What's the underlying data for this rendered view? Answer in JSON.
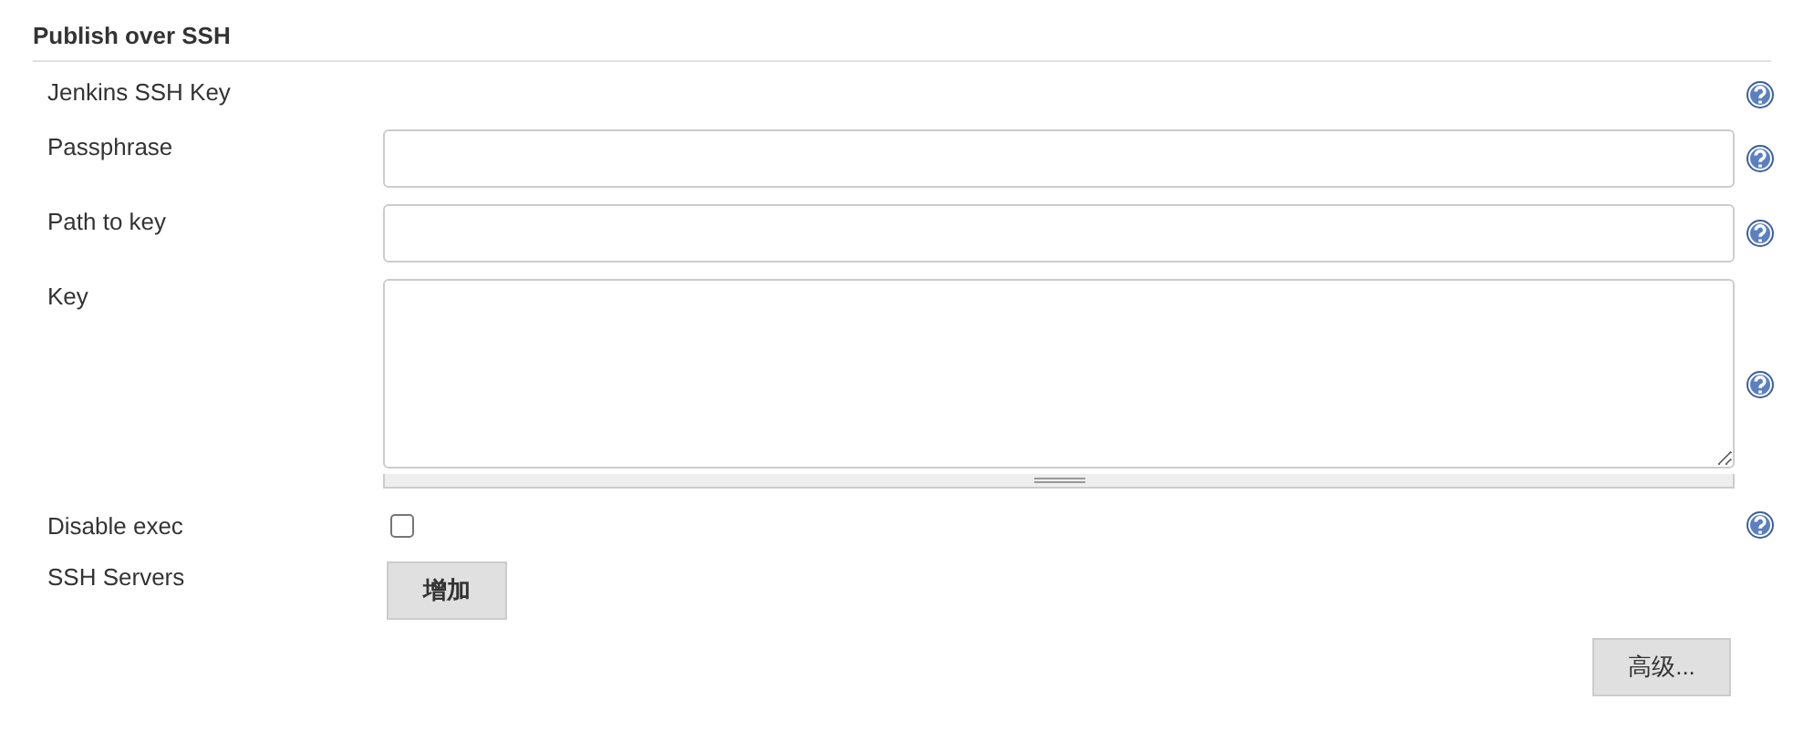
{
  "section": {
    "title": "Publish over SSH"
  },
  "rows": [
    {
      "kind": "label",
      "label": "Jenkins SSH Key",
      "help": true
    },
    {
      "kind": "text",
      "label": "Passphrase",
      "help": true
    },
    {
      "kind": "text",
      "label": "Path to key",
      "help": true
    },
    {
      "kind": "textarea",
      "label": "Key",
      "help": true
    },
    {
      "kind": "checkbox",
      "label": "Disable exec",
      "checked": false,
      "help": true
    },
    {
      "kind": "button",
      "label": "SSH Servers",
      "button": "增加",
      "help": false
    }
  ],
  "advanced_button": "高级..."
}
